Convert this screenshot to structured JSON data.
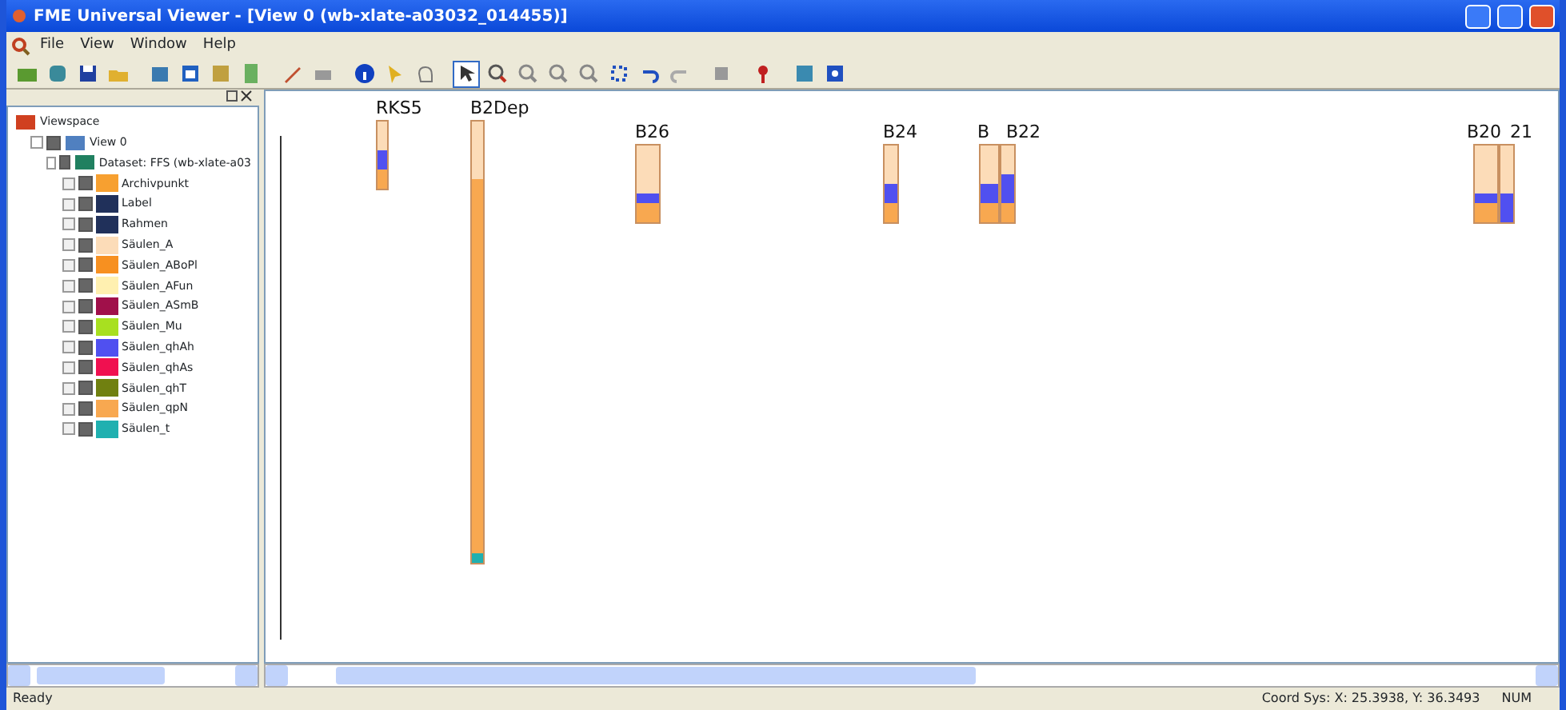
{
  "window": {
    "title": "FME Universal Viewer - [View 0 (wb-xlate-a03032_014455)]"
  },
  "menu": [
    "File",
    "View",
    "Window",
    "Help"
  ],
  "toolbar": [
    {
      "selected": false
    },
    {
      "selected": false
    },
    {
      "selected": false
    },
    {
      "selected": false
    },
    {
      "selected": false
    },
    {
      "selected": false
    },
    {
      "selected": false
    },
    {
      "selected": false
    },
    {
      "selected": false
    },
    {
      "selected": false
    },
    {
      "selected": false
    },
    {
      "selected": false
    },
    {
      "selected": false
    },
    {
      "selected": true
    },
    {
      "selected": false
    },
    {
      "selected": false
    },
    {
      "selected": false
    },
    {
      "selected": false
    },
    {
      "selected": false
    },
    {
      "selected": false
    },
    {
      "selected": false
    },
    {
      "selected": false
    },
    {
      "selected": false
    },
    {
      "selected": false
    },
    {
      "selected": false
    }
  ],
  "tree": {
    "label": "Viewspace",
    "children": [
      {
        "label": "View 0",
        "expanded": true,
        "checked": true,
        "children": [
          {
            "label": "Dataset: FFS (wb-xlate-a03",
            "expanded": true,
            "checked": true,
            "children": [
              {
                "label": "Archivpunkt",
                "checked": true,
                "color": "#f7a030"
              },
              {
                "label": "Label",
                "checked": true,
                "color": "#20305a"
              },
              {
                "label": "Rahmen",
                "checked": true,
                "color": "#20305a"
              },
              {
                "label": "Säulen_A",
                "checked": true,
                "color": "#fcdcb8"
              },
              {
                "label": "Säulen_ABoPl",
                "checked": true,
                "color": "#f79020"
              },
              {
                "label": "Säulen_AFun",
                "checked": true,
                "color": "#fff0b0"
              },
              {
                "label": "Säulen_ASmB",
                "checked": true,
                "color": "#a0104a"
              },
              {
                "label": "Säulen_Mu",
                "checked": true,
                "color": "#a8e020"
              },
              {
                "label": "Säulen_qhAh",
                "checked": true,
                "color": "#5050f0"
              },
              {
                "label": "Säulen_qhAs",
                "checked": true,
                "color": "#f01050"
              },
              {
                "label": "Säulen_qhT",
                "checked": true,
                "color": "#708010"
              },
              {
                "label": "Säulen_qpN",
                "checked": true,
                "color": "#f8a850"
              },
              {
                "label": "Säulen_t",
                "checked": true,
                "color": "#20b0b0"
              }
            ]
          }
        ]
      }
    ]
  },
  "boreholes": [
    {
      "label": "RKS5",
      "segments": [
        {
          "color": "#fcdcb8"
        },
        {
          "color": "#fcdcb8"
        },
        {
          "color": "#fcdcb8"
        },
        {
          "color": "#5050f0"
        },
        {
          "color": "#5050f0"
        },
        {
          "color": "#f8a850"
        },
        {
          "color": "#f8a850"
        }
      ]
    },
    {
      "label": "B2Dep",
      "segments": [
        {
          "color": "#fcdcb8"
        },
        {
          "color": "#fcdcb8"
        },
        {
          "color": "#fcdcb8"
        },
        {
          "color": "#fcdcb8"
        },
        {
          "color": "#fcdcb8"
        },
        {
          "color": "#fcdcb8"
        },
        {
          "color": "#f8a850"
        },
        {
          "color": "#f8a850"
        },
        {
          "color": "#f8a850"
        },
        {
          "color": "#f8a850"
        },
        {
          "color": "#f8a850"
        },
        {
          "color": "#f8a850"
        },
        {
          "color": "#f8a850"
        },
        {
          "color": "#f8a850"
        },
        {
          "color": "#f8a850"
        },
        {
          "color": "#f8a850"
        },
        {
          "color": "#f8a850"
        },
        {
          "color": "#f8a850"
        },
        {
          "color": "#f8a850"
        },
        {
          "color": "#f8a850"
        },
        {
          "color": "#f8a850"
        },
        {
          "color": "#f8a850"
        },
        {
          "color": "#f8a850"
        },
        {
          "color": "#f8a850"
        },
        {
          "color": "#f8a850"
        },
        {
          "color": "#f8a850"
        },
        {
          "color": "#f8a850"
        },
        {
          "color": "#f8a850"
        },
        {
          "color": "#f8a850"
        },
        {
          "color": "#f8a850"
        },
        {
          "color": "#f8a850"
        },
        {
          "color": "#f8a850"
        },
        {
          "color": "#f8a850"
        },
        {
          "color": "#f8a850"
        },
        {
          "color": "#f8a850"
        },
        {
          "color": "#f8a850"
        },
        {
          "color": "#f8a850"
        },
        {
          "color": "#f8a850"
        },
        {
          "color": "#f8a850"
        },
        {
          "color": "#f8a850"
        },
        {
          "color": "#f8a850"
        },
        {
          "color": "#f8a850"
        },
        {
          "color": "#f8a850"
        },
        {
          "color": "#f8a850"
        },
        {
          "color": "#f8a850"
        },
        {
          "color": "#20b0b0"
        }
      ]
    },
    {
      "label": "B26",
      "segments": [
        {
          "color": "#fcdcb8"
        },
        {
          "color": "#fcdcb8"
        },
        {
          "color": "#fcdcb8"
        },
        {
          "color": "#fcdcb8"
        },
        {
          "color": "#fcdcb8"
        },
        {
          "color": "#5050f0"
        },
        {
          "color": "#f8a850"
        },
        {
          "color": "#f8a850"
        }
      ]
    },
    {
      "label": "B24",
      "segments": [
        {
          "color": "#fcdcb8"
        },
        {
          "color": "#fcdcb8"
        },
        {
          "color": "#fcdcb8"
        },
        {
          "color": "#fcdcb8"
        },
        {
          "color": "#5050f0"
        },
        {
          "color": "#5050f0"
        },
        {
          "color": "#f8a850"
        },
        {
          "color": "#f8a850"
        }
      ]
    },
    {
      "label": "B",
      "segments": [
        {
          "color": "#fcdcb8"
        },
        {
          "color": "#fcdcb8"
        },
        {
          "color": "#fcdcb8"
        },
        {
          "color": "#fcdcb8"
        },
        {
          "color": "#5050f0"
        },
        {
          "color": "#5050f0"
        },
        {
          "color": "#f8a850"
        },
        {
          "color": "#f8a850"
        }
      ]
    },
    {
      "label": "B22",
      "segments": [
        {
          "color": "#fcdcb8"
        },
        {
          "color": "#fcdcb8"
        },
        {
          "color": "#fcdcb8"
        },
        {
          "color": "#5050f0"
        },
        {
          "color": "#5050f0"
        },
        {
          "color": "#5050f0"
        },
        {
          "color": "#f8a850"
        },
        {
          "color": "#f8a850"
        }
      ]
    },
    {
      "label": "B20",
      "segments": [
        {
          "color": "#fcdcb8"
        },
        {
          "color": "#fcdcb8"
        },
        {
          "color": "#fcdcb8"
        },
        {
          "color": "#fcdcb8"
        },
        {
          "color": "#fcdcb8"
        },
        {
          "color": "#5050f0"
        },
        {
          "color": "#f8a850"
        },
        {
          "color": "#f8a850"
        }
      ]
    },
    {
      "label": "21",
      "segments": [
        {
          "color": "#fcdcb8"
        },
        {
          "color": "#fcdcb8"
        },
        {
          "color": "#fcdcb8"
        },
        {
          "color": "#fcdcb8"
        },
        {
          "color": "#fcdcb8"
        },
        {
          "color": "#5050f0"
        },
        {
          "color": "#5050f0"
        },
        {
          "color": "#5050f0"
        }
      ]
    }
  ],
  "status_bar": {
    "message": "Ready",
    "coords": "Coord Sys: X: 25.3938, Y: 36.3493",
    "num": "NUM"
  }
}
